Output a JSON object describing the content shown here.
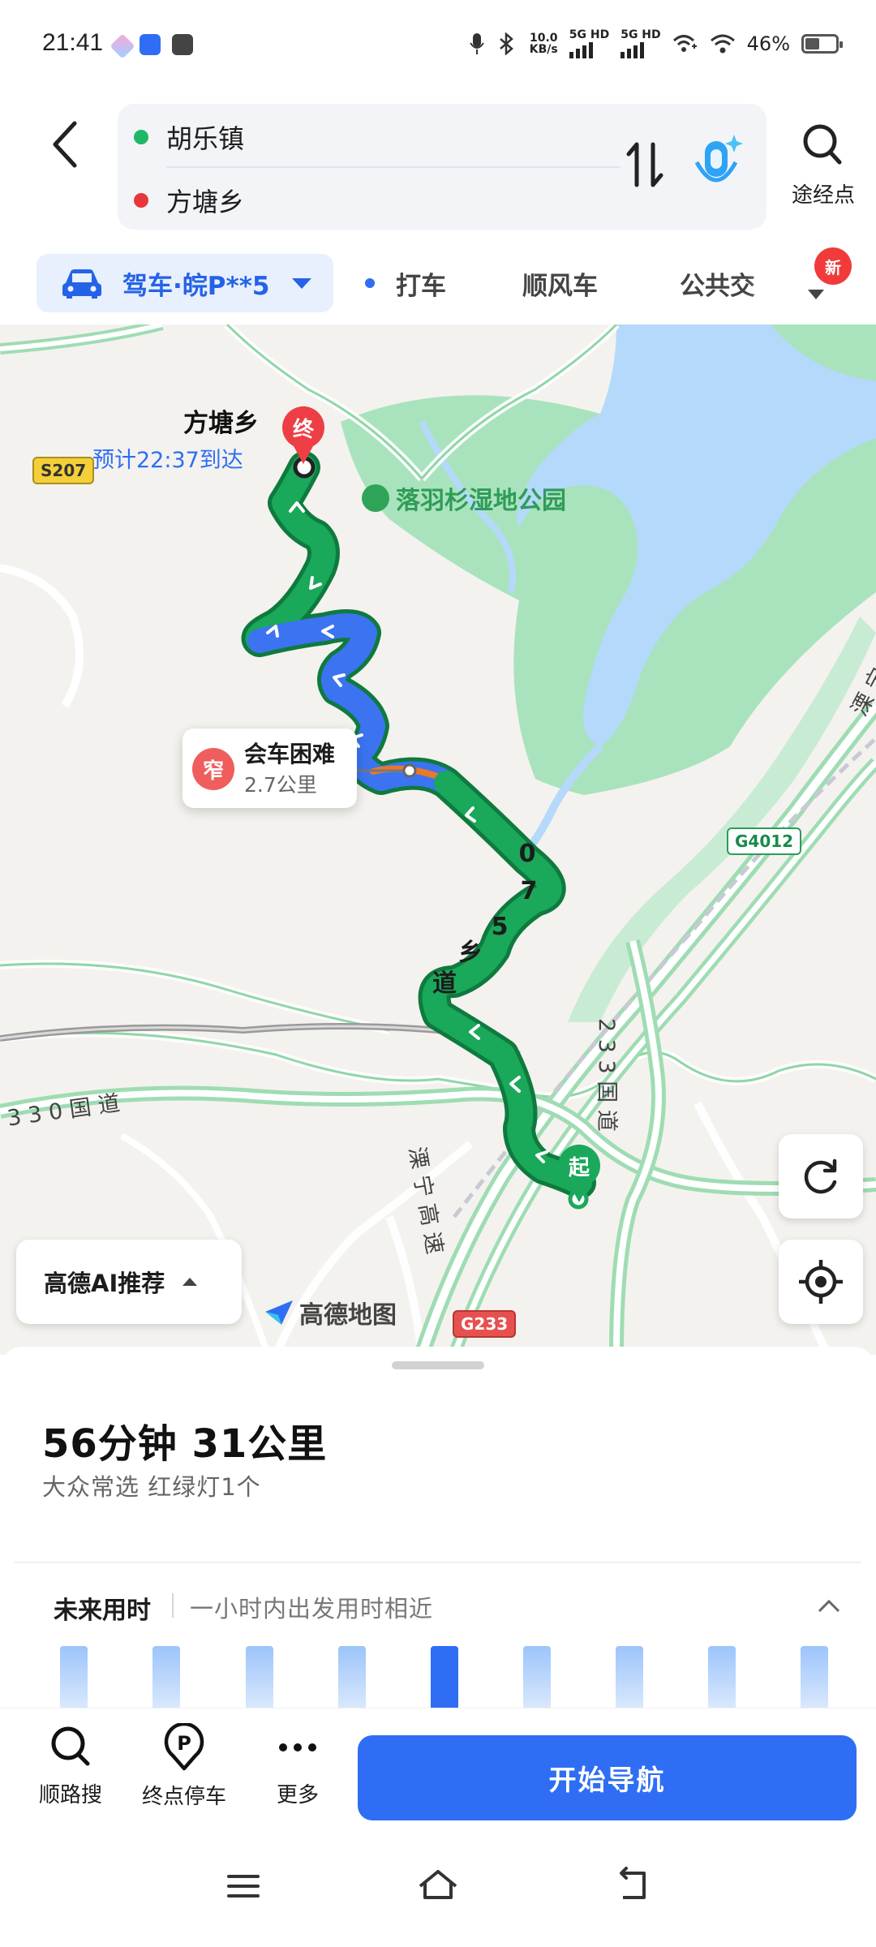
{
  "status_bar": {
    "time": "21:41",
    "net_speed_value": "10.0",
    "net_speed_unit": "KB/s",
    "sim1": "5G HD",
    "sim2": "5G HD",
    "battery": "46%"
  },
  "route": {
    "origin": "胡乐镇",
    "destination": "方塘乡",
    "origin_color": "#1db866",
    "destination_color": "#e8363a",
    "waypoint_label": "途经点"
  },
  "modes": {
    "active": "驾车·皖P**5",
    "items": [
      "打车",
      "顺风车",
      "公共交"
    ],
    "new_badge": "新"
  },
  "map": {
    "dest_name": "方塘乡",
    "eta": "预计22:37到达",
    "dest_marker": "终",
    "start_marker": "起",
    "poi": "落羽杉湿地公园",
    "shields": [
      "S207",
      "G4012",
      "G233"
    ],
    "road_labels": {
      "county_road": "0 7 5 乡 道",
      "national_330": "3 3 0 国 道",
      "national_233": "2 3 3 国 道",
      "expressway_left": "溧 宁 高 速",
      "expressway_right": "溧 宁"
    },
    "narrow_warning": {
      "icon": "窄",
      "title": "会车困难",
      "distance": "2.7公里"
    },
    "ai_recommend": "高德AI推荐",
    "logo": "高德地图",
    "route_color": "#1aa85a",
    "traffic_color": "#3b73f0"
  },
  "summary": {
    "duration_distance": "56分钟  31公里",
    "detail": "大众常选  红绿灯1个",
    "future_title": "未来用时",
    "future_note": "一小时内出发用时相近",
    "selected_bar": 4
  },
  "actions": {
    "search_along": "顺路搜",
    "dest_parking": "终点停车",
    "more": "更多",
    "start_nav": "开始导航"
  },
  "colors": {
    "accent": "#2f6ef4",
    "map_green": "#a9e3be",
    "map_water": "#b4d9fb"
  }
}
